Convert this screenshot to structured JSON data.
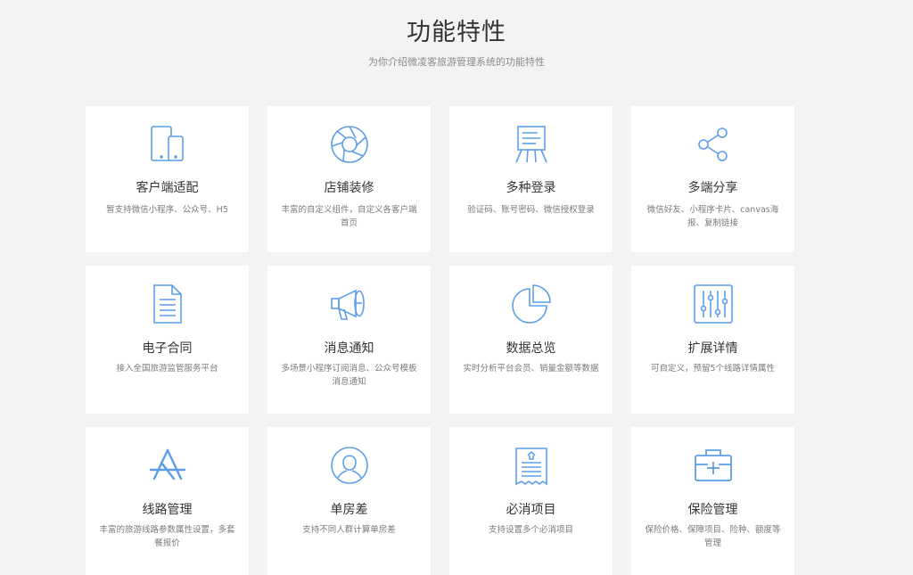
{
  "page": {
    "title": "功能特性",
    "subtitle": "为你介绍微凌客旅游管理系统的功能特性"
  },
  "accent_color": "#5c9ee8",
  "features": [
    {
      "icon": "device-adapt-icon",
      "title": "客户端适配",
      "desc": "暂支持微信小程序、公众号、H5"
    },
    {
      "icon": "aperture-icon",
      "title": "店铺装修",
      "desc": "丰富的自定义组件，自定义各客户端首页"
    },
    {
      "icon": "easel-board-icon",
      "title": "多种登录",
      "desc": "验证码、账号密码、微信授权登录"
    },
    {
      "icon": "share-icon",
      "title": "多端分享",
      "desc": "微信好友、小程序卡片、canvas海报、复制链接"
    },
    {
      "icon": "document-icon",
      "title": "电子合同",
      "desc": "接入全国旅游监管服务平台"
    },
    {
      "icon": "megaphone-icon",
      "title": "消息通知",
      "desc": "多场景小程序订阅消息、公众号模板消息通知"
    },
    {
      "icon": "pie-chart-icon",
      "title": "数据总览",
      "desc": "实时分析平台会员、销量金额等数据"
    },
    {
      "icon": "sliders-icon",
      "title": "扩展详情",
      "desc": "可自定义，预留5个线路详情属性"
    },
    {
      "icon": "app-store-icon",
      "title": "线路管理",
      "desc": "丰富的旅游线路参数属性设置，多套餐报价"
    },
    {
      "icon": "user-circle-icon",
      "title": "单房差",
      "desc": "支持不同人群计算单房差"
    },
    {
      "icon": "checklist-document-icon",
      "title": "必消项目",
      "desc": "支持设置多个必消项目"
    },
    {
      "icon": "first-aid-kit-icon",
      "title": "保险管理",
      "desc": "保险价格、保障项目、险种、额度等管理"
    }
  ]
}
